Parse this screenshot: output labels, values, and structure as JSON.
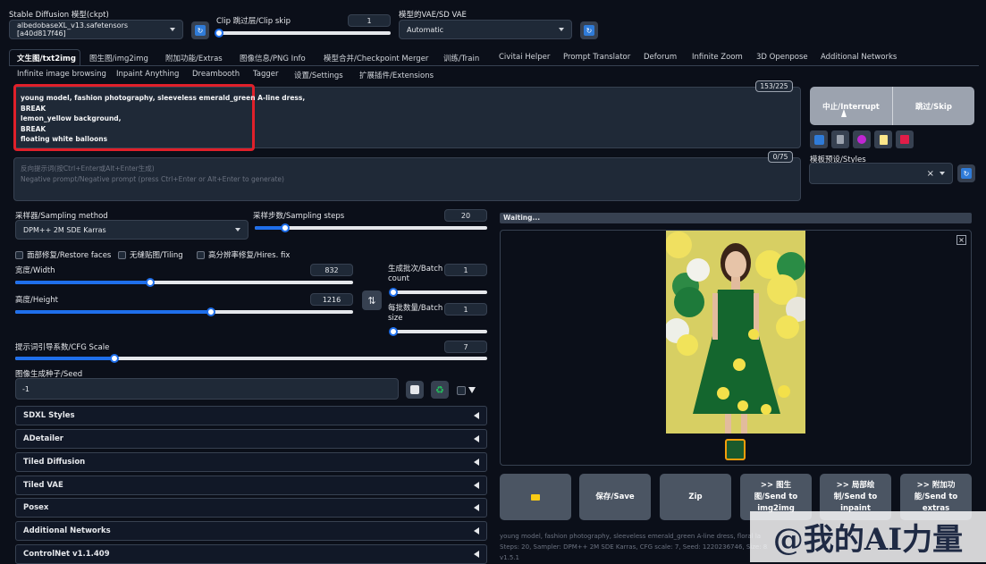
{
  "top": {
    "model_label": "Stable Diffusion 模型(ckpt)",
    "model_value": "albedobaseXL_v13.safetensors [a40d817f46]",
    "clip_label": "Clip 跳过层/Clip skip",
    "clip_value": "1",
    "vae_label": "模型的VAE/SD VAE",
    "vae_value": "Automatic"
  },
  "tabs_row1": [
    "文生图/txt2img",
    "图生图/img2img",
    "附加功能/Extras",
    "图像信息/PNG Info",
    "模型合并/Checkpoint Merger",
    "训练/Train",
    "Civitai Helper",
    "Prompt Translator",
    "Deforum",
    "Infinite Zoom",
    "3D Openpose",
    "Additional Networks"
  ],
  "tabs_row2": [
    "Infinite image browsing",
    "Inpaint Anything",
    "Dreambooth",
    "Tagger",
    "设置/Settings",
    "扩展插件/Extensions"
  ],
  "prompt": {
    "lines": [
      "young model, fashion photography, sleeveless emerald_green A-line dress,",
      "BREAK",
      "lemon_yellow background,",
      "BREAK",
      "floating white balloons"
    ],
    "token_count": "153/225",
    "neg_placeholder_1": "反向提示词(按Ctrl+Enter或Alt+Enter生成)",
    "neg_placeholder_2": "Negative prompt/Negative prompt (press Ctrl+Enter or Alt+Enter to generate)",
    "neg_count": "0/75"
  },
  "side": {
    "interrupt": "中止/Interrupt",
    "skip": "跳过/Skip",
    "styles_label": "模板预设/Styles",
    "clear": "×"
  },
  "params": {
    "sampler_label": "采样器/Sampling method",
    "sampler_value": "DPM++ 2M SDE Karras",
    "steps_label": "采样步数/Sampling steps",
    "steps_value": "20",
    "steps_frac": 0.13,
    "restore_faces": "面部修复/Restore faces",
    "tiling": "无缝贴图/Tiling",
    "hires": "高分辨率修复/Hires. fix",
    "width_label": "宽度/Width",
    "width_value": "832",
    "width_frac": 0.4,
    "height_label": "高度/Height",
    "height_value": "1216",
    "height_frac": 0.58,
    "batch_count_label_1": "生成批次/Batch",
    "batch_count_label_2": "count",
    "batch_count_value": "1",
    "batch_size_label_1": "每批数量/Batch",
    "batch_size_label_2": "size",
    "batch_size_value": "1",
    "cfg_label": "提示词引导系数/CFG Scale",
    "cfg_value": "7",
    "cfg_frac": 0.21,
    "seed_label": "图像生成种子/Seed",
    "seed_value": "-1"
  },
  "accordions": [
    "SDXL Styles",
    "ADetailer",
    "Tiled Diffusion",
    "Tiled VAE",
    "Posex",
    "Additional Networks",
    "ControlNet v1.1.409"
  ],
  "output": {
    "status": "Waiting...",
    "buttons": {
      "save": "保存/Save",
      "zip": "Zip",
      "img2img_1": ">> 图生",
      "img2img_2": "图/Send to",
      "img2img_3": "img2img",
      "inpaint_1": ">> 局部绘",
      "inpaint_2": "制/Send to",
      "inpaint_3": "inpaint",
      "extras_1": ">> 附加功",
      "extras_2": "能/Send to",
      "extras_3": "extras"
    },
    "info_1": "young model, fashion photography, sleeveless emerald_green A-line dress, floral la",
    "info_2": "Steps: 20, Sampler: DPM++ 2M SDE Karras, CFG scale: 7, Seed: 1220236746, Size: 83",
    "info_3": "v1.5.1"
  },
  "watermark": "@我的AI力量",
  "colors": {
    "accent": "#1f6feb",
    "highlight": "#e0202a",
    "bg": "#0b0f19"
  }
}
